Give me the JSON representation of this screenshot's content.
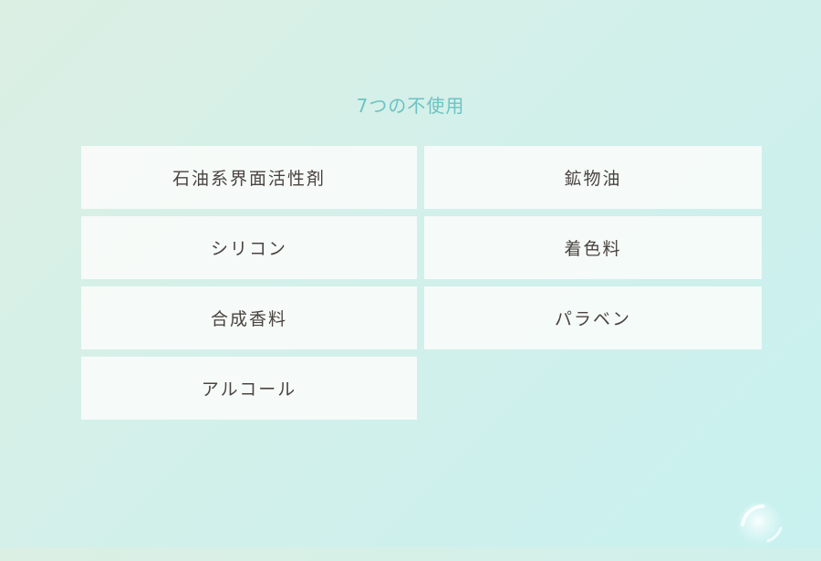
{
  "heading": "7つの不使用",
  "items": [
    "石油系界面活性剤",
    "鉱物油",
    "シリコン",
    "着色料",
    "合成香料",
    "パラベン",
    "アルコール"
  ],
  "colors": {
    "heading": "#6cc3c4",
    "item_text": "#4a4340",
    "cell_background": "#f8fbfa"
  }
}
